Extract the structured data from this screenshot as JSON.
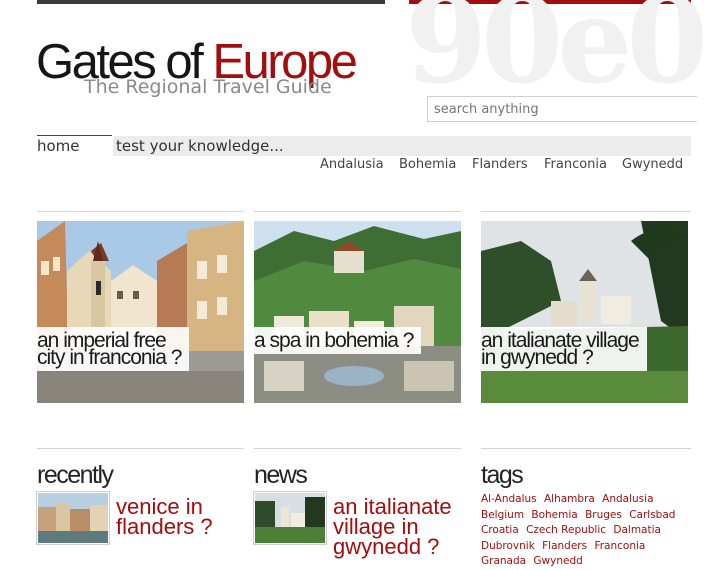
{
  "header": {
    "logo_part1": "Gates of ",
    "logo_part2": "Europe",
    "tagline": "The Regional Travel Guide",
    "watermark": "90e0"
  },
  "search": {
    "placeholder": "search anything"
  },
  "nav": {
    "home": "home",
    "quiz": "test your knowledge..."
  },
  "regions": [
    "Andalusia",
    "Bohemia",
    "Flanders",
    "Franconia",
    "Gwynedd"
  ],
  "features": [
    {
      "line1": "an imperial free",
      "line2": "city in franconia ?"
    },
    {
      "line1": "a spa in bohemia ?",
      "line2": ""
    },
    {
      "line1": "an italianate village",
      "line2": "in gwynedd ?"
    }
  ],
  "sections": {
    "recently": {
      "title": "recently",
      "item_line1": "venice in",
      "item_line2": "flanders ?"
    },
    "news": {
      "title": "news",
      "item_line1": "an italianate",
      "item_line2": "village in",
      "item_line3": "gwynedd ?"
    },
    "tags": {
      "title": "tags",
      "items": [
        "Al-Andalus",
        "Alhambra",
        "Andalusia",
        "Belgium",
        "Bohemia",
        "Bruges",
        "Carlsbad",
        "Croatia",
        "Czech Republic",
        "Dalmatia",
        "Dubrovnik",
        "Flanders",
        "Franconia",
        "Granada",
        "Gwynedd"
      ]
    }
  },
  "colors": {
    "accent": "#a30d0d",
    "dark_bar": "#3a3a3a",
    "nav_bg": "#ececec"
  }
}
